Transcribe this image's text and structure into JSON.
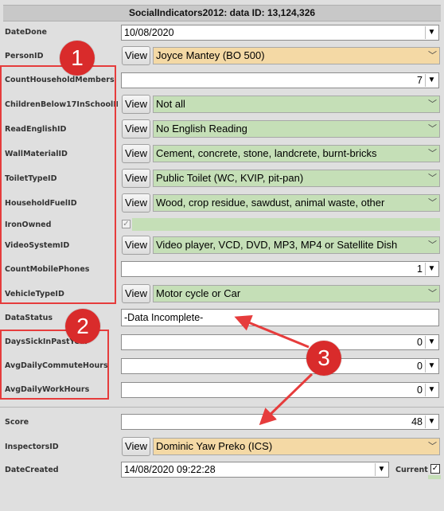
{
  "title": "SocialIndicators2012: data ID: 13,124,326",
  "view_label": "View",
  "fields": {
    "date_done": {
      "label": "DateDone",
      "value": "10/08/2020"
    },
    "person_id": {
      "label": "PersonID",
      "value": "Joyce Mantey (BO 500)"
    },
    "count_household_members": {
      "label": "CountHouseholdMembers",
      "value": "7"
    },
    "children_below_17": {
      "label": "ChildrenBelow17InSchoolID",
      "value": "Not all"
    },
    "read_english": {
      "label": "ReadEnglishID",
      "value": "No English Reading"
    },
    "wall_material": {
      "label": "WallMaterialID",
      "value": "Cement, concrete, stone, landcrete, burnt-bricks"
    },
    "toilet_type": {
      "label": "ToiletTypeID",
      "value": "Public Toilet (WC, KVIP, pit-pan)"
    },
    "household_fuel": {
      "label": "HouseholdFuelID",
      "value": "Wood, crop residue, sawdust, animal waste, other"
    },
    "iron_owned": {
      "label": "IronOwned",
      "checked": true
    },
    "video_system": {
      "label": "VideoSystemID",
      "value": "Video player, VCD, DVD, MP3, MP4 or Satellite Dish"
    },
    "count_mobile_phones": {
      "label": "CountMobilePhones",
      "value": "1"
    },
    "vehicle_type": {
      "label": "VehicleTypeID",
      "value": "Motor cycle or Car"
    },
    "data_status": {
      "label": "DataStatus",
      "value": "-Data Incomplete-"
    },
    "days_sick": {
      "label": "DaysSickInPastYear",
      "value": "0"
    },
    "avg_commute": {
      "label": "AvgDailyCommuteHours",
      "value": "0"
    },
    "avg_work": {
      "label": "AvgDailyWorkHours",
      "value": "0"
    },
    "score": {
      "label": "Score",
      "value": "48"
    },
    "inspectors": {
      "label": "InspectorsID",
      "value": "Dominic Yaw Preko (ICS)"
    },
    "date_created": {
      "label": "DateCreated",
      "value": "14/08/2020 09:22:28"
    },
    "current": {
      "label": "Current",
      "checked": true
    }
  },
  "annotations": {
    "badge1": "1",
    "badge2": "2",
    "badge3": "3"
  },
  "colors": {
    "green_field": "#c5dfb7",
    "orange_field": "#f4d9a5",
    "annotation_red": "#d92b2b"
  }
}
